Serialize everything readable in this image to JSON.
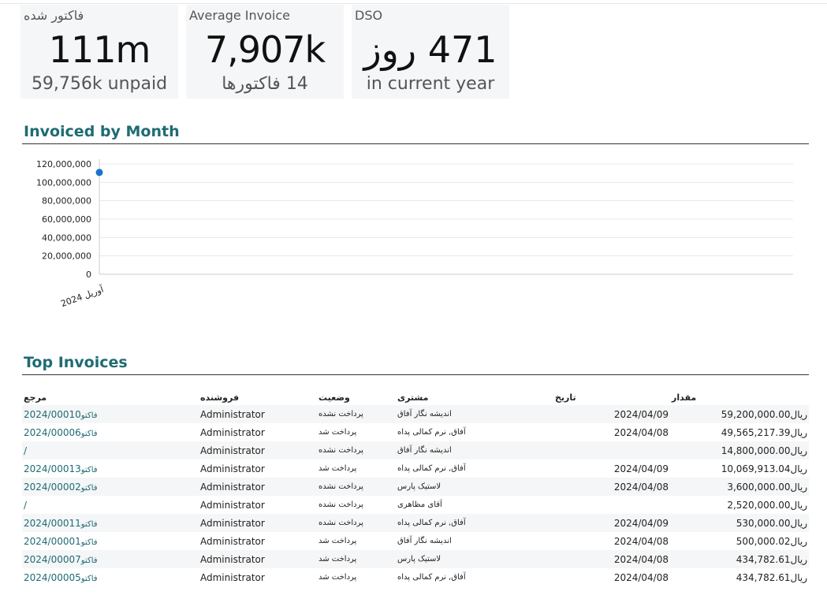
{
  "kpis": {
    "invoiced": {
      "label": "فاکتور شده",
      "value": "111m",
      "sub": "59,756k unpaid"
    },
    "average": {
      "label": "Average Invoice",
      "value": "7,907k",
      "sub": "14 فاکتورها"
    },
    "dso": {
      "label": "DSO",
      "value": "471 روز",
      "sub": "in current year"
    }
  },
  "sections": {
    "chart_title": "Invoiced by Month",
    "table_title": "Top Invoices"
  },
  "chart_data": {
    "type": "line",
    "categories": [
      "آوریل 2024"
    ],
    "series": [
      {
        "values": [
          110741217.42
        ]
      }
    ],
    "ylim": [
      0,
      120000000
    ],
    "yticks": [
      "0",
      "20,000,000",
      "40,000,000",
      "60,000,000",
      "80,000,000",
      "100,000,000",
      "120,000,000"
    ],
    "grid": true,
    "color": "#1a73c7"
  },
  "table": {
    "headers": {
      "ref": "مرجع",
      "seller": "فروشنده",
      "status": "وضعیت",
      "customer": "مشتری",
      "date": "تاریخ",
      "amount": "مقدار"
    },
    "rows": [
      {
        "ref_prefix": "فاکتو",
        "ref_num": "2024/00010",
        "seller": "Administrator",
        "status": "پرداخت نشده",
        "customer": "اندیشه نگار آفاق",
        "date": "2024/04/09",
        "amount": "59,200,000.00",
        "currency": "ریال"
      },
      {
        "ref_prefix": "فاکتو",
        "ref_num": "2024/00006",
        "seller": "Administrator",
        "status": "پرداخت شد",
        "customer": "آفاق, نرم کمالی پداه",
        "date": "2024/04/08",
        "amount": "49,565,217.39",
        "currency": "ریال"
      },
      {
        "ref_prefix": "",
        "ref_num": "/",
        "seller": "Administrator",
        "status": "پرداخت نشده",
        "customer": "اندیشه نگار آفاق",
        "date": "",
        "amount": "14,800,000.00",
        "currency": "ریال"
      },
      {
        "ref_prefix": "فاکتو",
        "ref_num": "2024/00013",
        "seller": "Administrator",
        "status": "پرداخت شد",
        "customer": "آفاق, نرم کمالی پداه",
        "date": "2024/04/09",
        "amount": "10,069,913.04",
        "currency": "ریال"
      },
      {
        "ref_prefix": "فاکتو",
        "ref_num": "2024/00002",
        "seller": "Administrator",
        "status": "پرداخت نشده",
        "customer": "لاستیک پارس",
        "date": "2024/04/08",
        "amount": "3,600,000.00",
        "currency": "ریال"
      },
      {
        "ref_prefix": "",
        "ref_num": "/",
        "seller": "Administrator",
        "status": "پرداخت نشده",
        "customer": "آقای مظاهری",
        "date": "",
        "amount": "2,520,000.00",
        "currency": "ریال"
      },
      {
        "ref_prefix": "فاکتو",
        "ref_num": "2024/00011",
        "seller": "Administrator",
        "status": "پرداخت نشده",
        "customer": "آفاق, نرم کمالی پداه",
        "date": "2024/04/09",
        "amount": "530,000.00",
        "currency": "ریال"
      },
      {
        "ref_prefix": "فاکتو",
        "ref_num": "2024/00001",
        "seller": "Administrator",
        "status": "پرداخت شد",
        "customer": "اندیشه نگار آفاق",
        "date": "2024/04/08",
        "amount": "500,000.02",
        "currency": "ریال"
      },
      {
        "ref_prefix": "فاکتو",
        "ref_num": "2024/00007",
        "seller": "Administrator",
        "status": "پرداخت شد",
        "customer": "لاستیک پارس",
        "date": "2024/04/08",
        "amount": "434,782.61",
        "currency": "ریال"
      },
      {
        "ref_prefix": "فاکتو",
        "ref_num": "2024/00005",
        "seller": "Administrator",
        "status": "پرداخت شد",
        "customer": "آفاق, نرم کمالی پداه",
        "date": "2024/04/08",
        "amount": "434,782.61",
        "currency": "ریال"
      }
    ]
  }
}
